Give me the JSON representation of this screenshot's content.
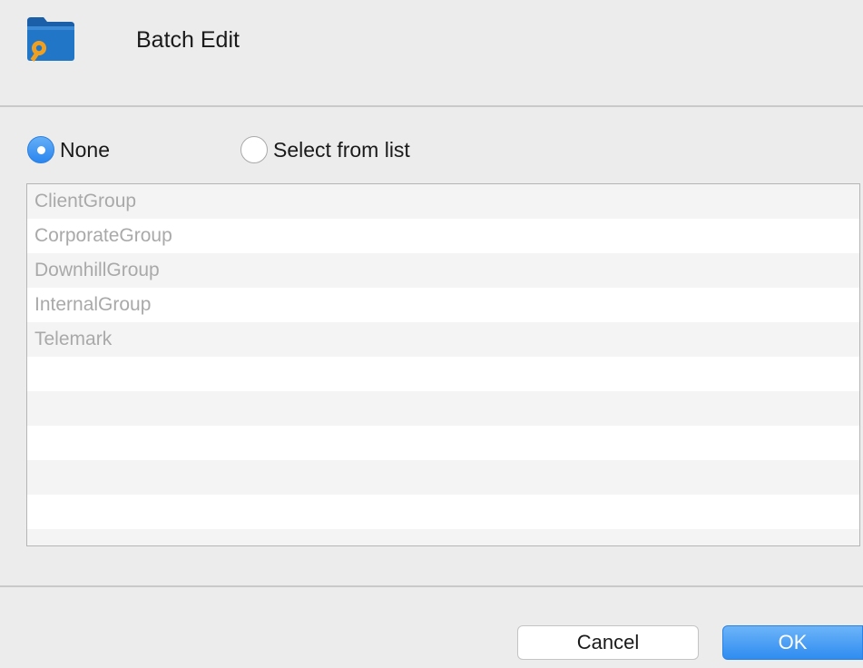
{
  "header": {
    "title": "Batch Edit",
    "icon": "folder-key-icon"
  },
  "radios": {
    "none": {
      "label": "None",
      "selected": true
    },
    "select_from_list": {
      "label": "Select from list",
      "selected": false
    }
  },
  "groups": [
    "ClientGroup",
    "CorporateGroup",
    "DownhillGroup",
    "InternalGroup",
    "Telemark",
    "",
    "",
    "",
    "",
    "",
    ""
  ],
  "buttons": {
    "cancel": "Cancel",
    "ok": "OK"
  },
  "colors": {
    "accent": "#2f8cf0",
    "folder": "#1f6fc2",
    "key": "#f0a020",
    "list_text_disabled": "#a9a9a9"
  }
}
